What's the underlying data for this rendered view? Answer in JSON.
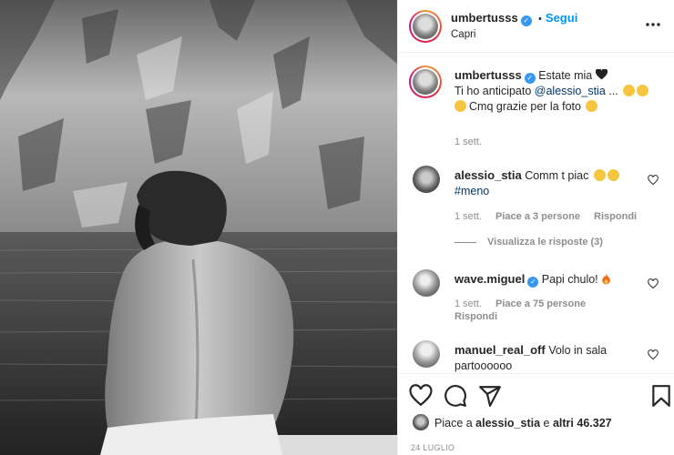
{
  "post": {
    "username": "umbertusss",
    "follow_label": "Segui",
    "location": "Capri"
  },
  "caption": {
    "username": "umbertusss",
    "line1": "Estate mia",
    "line2_pre": "Ti ho anticipato ",
    "line2_mention": "@alessio_stia",
    "line2_post": " ...",
    "line3": "Cmq grazie per la foto",
    "time": "1 sett."
  },
  "comments": [
    {
      "username": "alessio_stia",
      "text": "Comm t piac",
      "hashtag": "#meno",
      "time": "1 sett.",
      "likes": "Piace a 3 persone",
      "reply": "Rispondi",
      "view_replies": "Visualizza le risposte (3)"
    },
    {
      "username": "wave.miguel",
      "text": "Papi chulo!",
      "time": "1 sett.",
      "likes": "Piace a 75 persone",
      "reply": "Rispondi"
    },
    {
      "username": "manuel_real_off",
      "text_line1": "Volo in sala",
      "text_line2": "partoooooo"
    }
  ],
  "footer": {
    "likes_pre": "Piace a ",
    "likes_user": "alessio_stia",
    "likes_mid": " e ",
    "likes_count": "altri 46.327",
    "date": "24 LUGLIO"
  },
  "icons": {
    "like": "heart-icon",
    "comment": "comment-icon",
    "share": "share-icon",
    "save": "bookmark-icon",
    "more": "more-dots-icon"
  },
  "colors": {
    "accent": "#0095f6",
    "verified": "#3897f0",
    "mention": "#00376b",
    "muted": "#8e8e8e"
  }
}
